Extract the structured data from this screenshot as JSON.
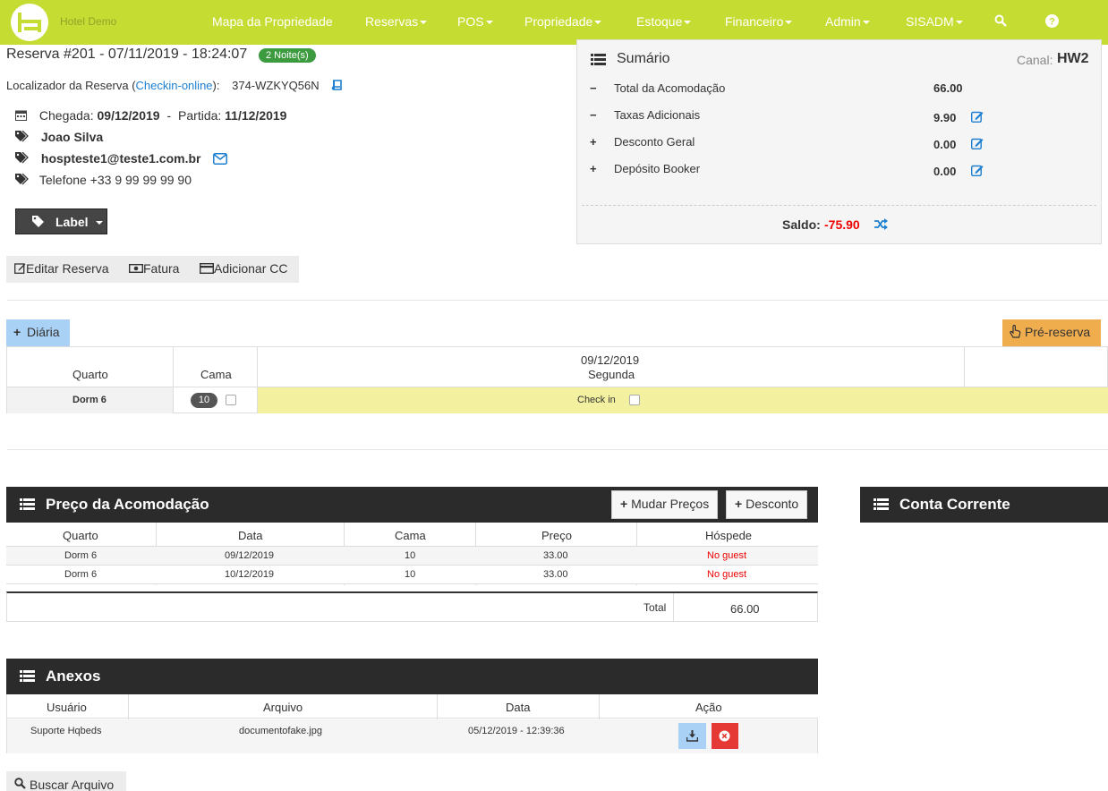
{
  "navbar": {
    "brand": "Hotel Demo",
    "items": [
      {
        "label": "Mapa da Propriedade",
        "dropdown": false
      },
      {
        "label": "Reservas",
        "dropdown": true
      },
      {
        "label": "POS",
        "dropdown": true
      },
      {
        "label": "Propriedade",
        "dropdown": true
      },
      {
        "label": "Estoque",
        "dropdown": true
      },
      {
        "label": "Financeiro",
        "dropdown": true
      },
      {
        "label": "Admin",
        "dropdown": true
      },
      {
        "label": "SISADM",
        "dropdown": true
      }
    ],
    "icons": [
      "search-icon",
      "help-icon"
    ],
    "color": "#c5dc32"
  },
  "reservation": {
    "title_prefix": "Reserva #201 - 07/11/2019 - 18:24:07",
    "nights_badge": "2 Noite(s)",
    "locator_label": "Localizador da Reserva (",
    "checkin_online": "Checkin-online",
    "locator_suffix": "):",
    "locator_code": "374-WZKYQ56N",
    "arrival_label": "Chegada:",
    "arrival_date": "09/12/2019",
    "departure_label": "Partida:",
    "departure_date": "11/12/2019",
    "guest_name": "Joao Silva",
    "email": "hospteste1@teste1.com.br",
    "phone": "Telefone +33 9 99 99 99 90",
    "label_button": "Label",
    "actions": {
      "edit": "Editar Reserva",
      "invoice": "Fatura",
      "add_cc": "Adicionar CC"
    }
  },
  "summary": {
    "title": "Sumário",
    "channel_label": "Canal:",
    "channel_value": "HW2",
    "rows": [
      {
        "sign": "−",
        "label": "Total da Acomodação",
        "value": "66.00",
        "editable": false
      },
      {
        "sign": "−",
        "label": "Taxas Adicionais",
        "value": "9.90",
        "editable": true
      },
      {
        "sign": "+",
        "label": "Desconto Geral",
        "value": "0.00",
        "editable": true
      },
      {
        "sign": "+",
        "label": "Depósito Booker",
        "value": "0.00",
        "editable": true
      }
    ],
    "balance_label": "Saldo:",
    "balance_value": "-75.90"
  },
  "daily": {
    "add_button": "Diária",
    "pre_reserve_button": "Pré-reserva",
    "header": {
      "room": "Quarto",
      "bed": "Cama",
      "date": "09/12/2019",
      "weekday": "Segunda"
    },
    "row": {
      "room": "Dorm 6",
      "bed": "10",
      "status": "Check in"
    }
  },
  "price": {
    "title": "Preço da Acomodação",
    "change_prices": "Mudar Preços",
    "discount": "Desconto",
    "columns": [
      "Quarto",
      "Data",
      "Cama",
      "Preço",
      "Hóspede"
    ],
    "rows": [
      [
        "Dorm 6",
        "09/12/2019",
        "10",
        "33.00",
        "No guest"
      ],
      [
        "Dorm 6",
        "10/12/2019",
        "10",
        "33.00",
        "No guest"
      ]
    ],
    "total_label": "Total",
    "total_value": "66.00"
  },
  "account": {
    "title": "Conta Corrente"
  },
  "attachments": {
    "title": "Anexos",
    "columns": [
      "Usuário",
      "Arquivo",
      "Data",
      "Ação"
    ],
    "rows": [
      [
        "Suporte Hqbeds",
        "documentofake.jpg",
        "05/12/2019 - 12:39:36"
      ]
    ],
    "search_button": "Buscar Arquivo"
  },
  "colors": {
    "accent": "#c5dc32",
    "link": "#1d7fd1",
    "badge": "#3c9a3f",
    "balance_negative": "#e00000",
    "pre_reserve": "#f0ad4e",
    "checkin_cell": "#f3f1a0",
    "diaria_button": "#a9d0f5"
  }
}
